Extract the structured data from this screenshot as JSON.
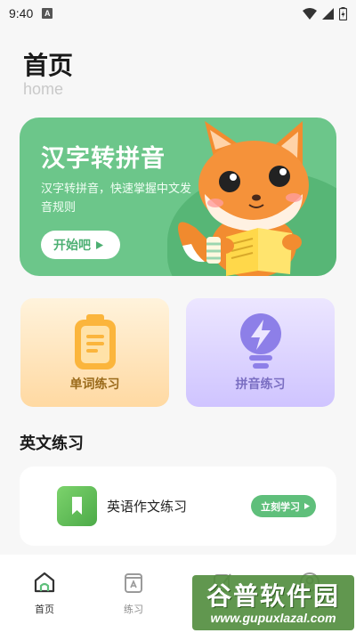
{
  "status_bar": {
    "time": "9:40",
    "notification_icon": "A",
    "icons": [
      "wifi-icon",
      "signal-icon",
      "battery-icon"
    ]
  },
  "header": {
    "title": "首页",
    "subtitle": "home"
  },
  "banner": {
    "title": "汉字转拼音",
    "description": "汉字转拼音，快速掌握中文发音规则",
    "button_label": "开始吧",
    "background_color": "#6cc68a"
  },
  "cards": {
    "word": {
      "label": "单词练习",
      "icon": "clipboard-icon"
    },
    "pinyin": {
      "label": "拼音练习",
      "icon": "lightbulb-icon"
    }
  },
  "english_section": {
    "title": "英文练习",
    "item_label": "英语作文练习",
    "item_icon": "bookmark-book-icon",
    "button_label": "立刻学习",
    "accent_color": "#5fbf7b"
  },
  "tab_bar": {
    "tabs": [
      {
        "label": "首页",
        "icon": "home-icon",
        "active": true
      },
      {
        "label": "练习",
        "icon": "practice-icon",
        "active": false
      },
      {
        "label": "",
        "icon": "edit-icon",
        "active": false
      },
      {
        "label": "",
        "icon": "profile-icon",
        "active": false
      }
    ]
  },
  "watermark": {
    "title": "谷普软件园",
    "url": "www.gupuxlazal.com"
  }
}
